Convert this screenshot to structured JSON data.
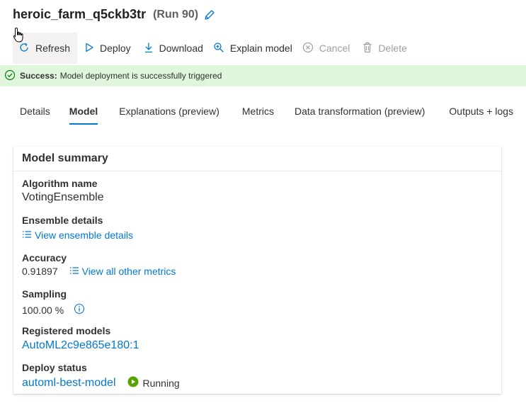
{
  "header": {
    "run_name": "heroic_farm_q5ckb3tr",
    "run_number": "(Run 90)"
  },
  "toolbar": {
    "refresh": "Refresh",
    "deploy": "Deploy",
    "download": "Download",
    "explain_model": "Explain model",
    "cancel": "Cancel",
    "delete": "Delete"
  },
  "banner": {
    "title": "Success:",
    "message": "Model deployment is successfully triggered",
    "status_color": "#107c10"
  },
  "tabs": [
    {
      "label": "Details"
    },
    {
      "label": "Model"
    },
    {
      "label": "Explanations (preview)"
    },
    {
      "label": "Metrics"
    },
    {
      "label": "Data transformation (preview)"
    },
    {
      "label": "Outputs + logs"
    }
  ],
  "active_tab": "Model",
  "model_summary": {
    "title": "Model summary",
    "algorithm_label": "Algorithm name",
    "algorithm_value": "VotingEnsemble",
    "ensemble_label": "Ensemble details",
    "ensemble_link": "View ensemble details",
    "accuracy_label": "Accuracy",
    "accuracy_value": "0.91897",
    "accuracy_link": "View all other metrics",
    "sampling_label": "Sampling",
    "sampling_value": "100.00 %",
    "registered_label": "Registered models",
    "registered_value": "AutoML2c9e865e180:1",
    "deploy_label": "Deploy status",
    "deploy_value": "automl-best-model",
    "deploy_state": "Running"
  },
  "colors": {
    "accent": "#0078d4",
    "success_bg": "#dff6dd",
    "running": "#57a300"
  },
  "icons": [
    "edit-icon",
    "refresh-icon",
    "play-icon",
    "download-icon",
    "explain-icon",
    "cancel-icon",
    "delete-icon",
    "check-circle-icon",
    "list-icon",
    "info-icon",
    "running-icon",
    "pointer-cursor-icon"
  ]
}
